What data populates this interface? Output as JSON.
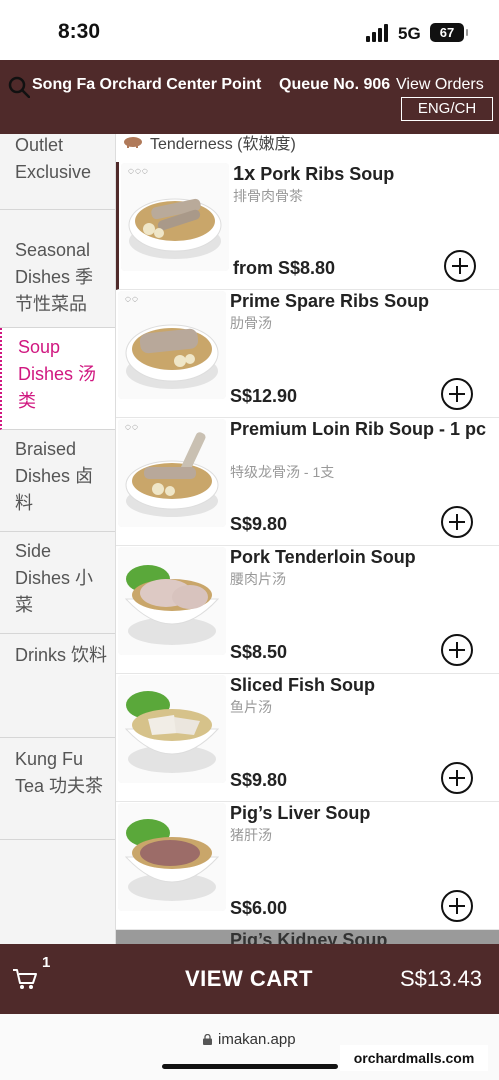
{
  "status_bar": {
    "time": "8:30",
    "network": "5G",
    "battery": "67"
  },
  "header": {
    "store_name": "Song Fa Orchard Center Point",
    "queue": "Queue No. 906",
    "view_orders": "View Orders",
    "language": "ENG/CH"
  },
  "sidebar": {
    "items": [
      {
        "label": "Outlet Exclusive"
      },
      {
        "label": "Seasonal Dishes 季节性菜品"
      },
      {
        "label": "Soup Dishes 汤类",
        "active": true
      },
      {
        "label": "Braised Dishes 卤料"
      },
      {
        "label": "Side Dishes 小菜"
      },
      {
        "label": "Drinks 饮料"
      },
      {
        "label": "Kung Fu Tea 功夫茶"
      }
    ]
  },
  "list": {
    "tenderness_label": "Tenderness (软嫩度)",
    "items": [
      {
        "qty": "1x",
        "name": "Pork Ribs Soup",
        "name_cn": "排骨肉骨茶",
        "price": "from S$8.80"
      },
      {
        "name": "Prime Spare Ribs Soup",
        "name_cn": "肋骨汤",
        "price": "S$12.90"
      },
      {
        "name": "Premium Loin Rib Soup - 1 pc",
        "name_cn": "特级龙骨汤 - 1支",
        "price": "S$9.80"
      },
      {
        "name": "Pork Tenderloin Soup",
        "name_cn": "腰肉片汤",
        "price": "S$8.50"
      },
      {
        "name": "Sliced Fish Soup",
        "name_cn": "鱼片汤",
        "price": "S$9.80"
      },
      {
        "name": "Pig’s Liver Soup",
        "name_cn": "猪肝汤",
        "price": "S$6.00"
      },
      {
        "name": "Pig’s Kidney Soup",
        "status": "Not Available"
      }
    ]
  },
  "cart": {
    "count": "1",
    "label": "VIEW CART",
    "total": "S$13.43"
  },
  "browser": {
    "url": "imakan.app"
  },
  "watermark": "orchardmalls.com",
  "colors": {
    "header": "#4f2a2a",
    "active_category": "#d01880"
  }
}
